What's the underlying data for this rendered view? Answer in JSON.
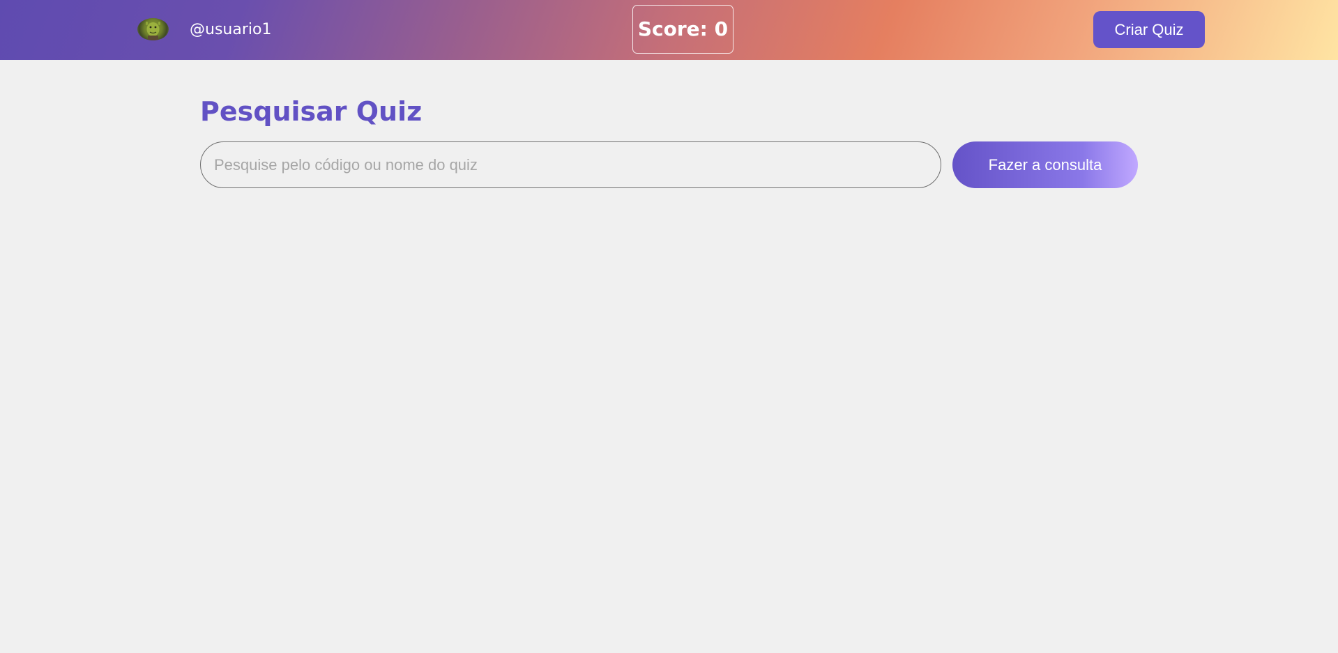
{
  "header": {
    "username": "@usuario1",
    "score": "Score: 0",
    "create_button": "Criar Quiz",
    "avatar_icon": "avatar-shrek-image"
  },
  "main": {
    "title": "Pesquisar Quiz",
    "search": {
      "placeholder": "Pesquise pelo código ou nome do quiz",
      "value": "",
      "button": "Fazer a consulta"
    }
  },
  "colors": {
    "accent": "#6151c4",
    "background": "#f0f0f0"
  }
}
